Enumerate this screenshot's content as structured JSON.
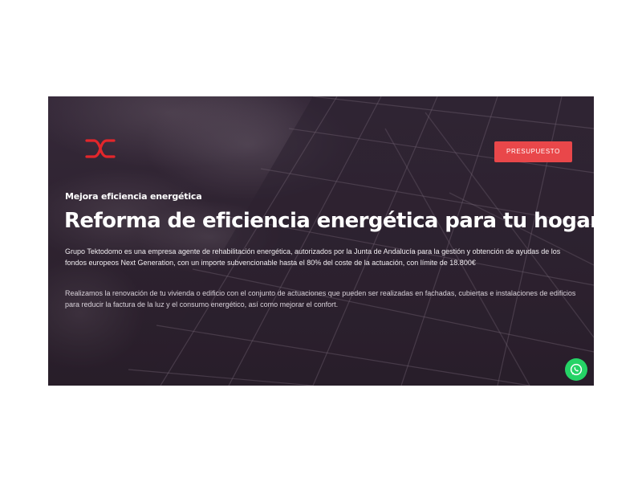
{
  "header": {
    "logo_icon": "tektodomo-logo-icon",
    "cta_label": "PRESUPUESTO"
  },
  "hero": {
    "eyebrow": "Mejora eficiencia energética",
    "title": "Reforma de eficiencia energética para tu hogar",
    "paragraph_1": "Grupo Tektodomo es una empresa agente de rehabilitación energética, autorizados por la Junta de Andalucía para la gestión y obtención de ayudas de los fondos europeos Next Generation, con un importe subvencionable hasta el 80% del coste de la actuación, con límite de 18.800€",
    "paragraph_2": "Realizamos la renovación de tu vivienda o edificio con el conjunto de actuaciones que pueden ser realizadas en fachadas, cubiertas e instalaciones de edificios para reducir la factura de la luz y el consumo energético, así como mejorar el confort."
  },
  "floating": {
    "whatsapp_icon": "whatsapp-icon"
  },
  "colors": {
    "accent": "#e9474a",
    "whatsapp": "#25d366",
    "overlay": "#2f2331"
  }
}
